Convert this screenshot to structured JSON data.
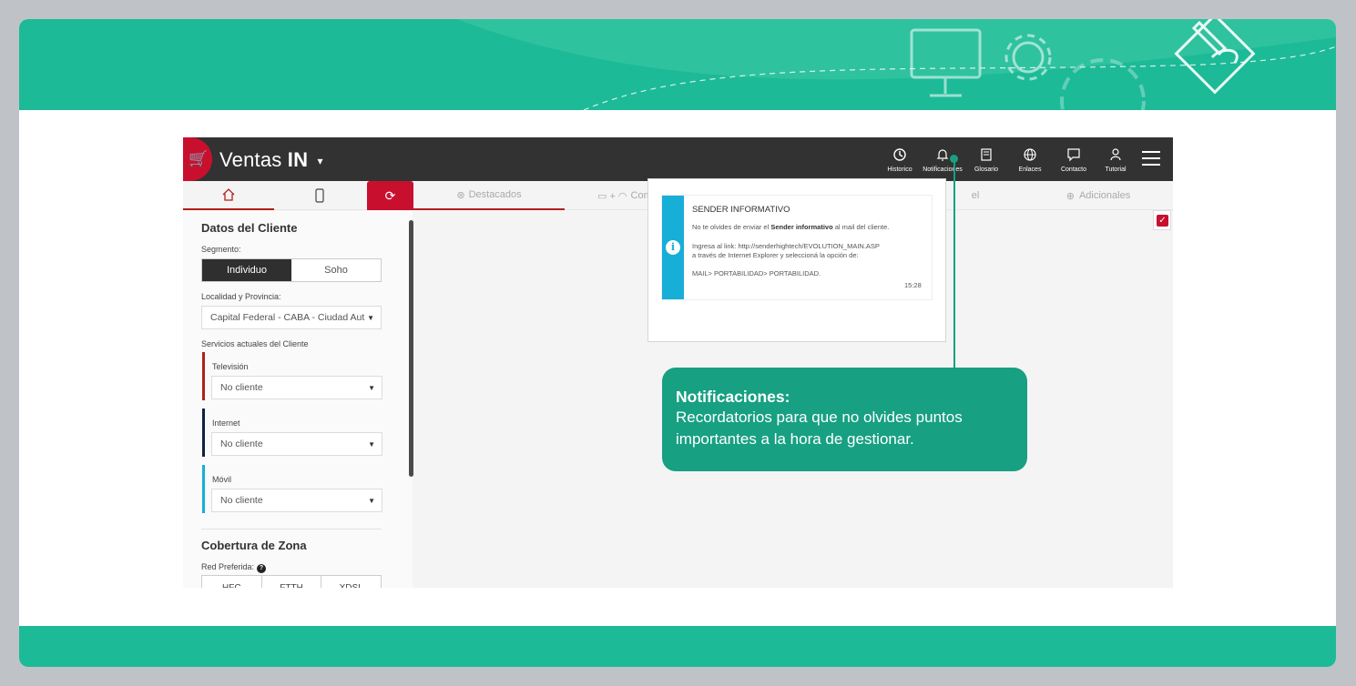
{
  "app": {
    "brand_light": "Ventas",
    "brand_bold": "IN",
    "caret": "▾",
    "nav": [
      {
        "label": "Historico",
        "icon": "history-icon"
      },
      {
        "label": "Notificaciones",
        "icon": "bell-icon"
      },
      {
        "label": "Glosario",
        "icon": "book-icon"
      },
      {
        "label": "Enlaces",
        "icon": "globe-icon"
      },
      {
        "label": "Contacto",
        "icon": "chat-icon"
      },
      {
        "label": "Tutorial",
        "icon": "user-guide-icon"
      }
    ]
  },
  "tabs": {
    "destacados": "Destacados",
    "comp": "Com",
    "el": "el",
    "adicionales": "Adicionales"
  },
  "cliente": {
    "title": "Datos del Cliente",
    "segmento_label": "Segmento:",
    "segmento_options": [
      "Individuo",
      "Soho"
    ],
    "localidad_label": "Localidad y Provincia:",
    "localidad_value": "Capital Federal - CABA - Ciudad Aut",
    "servicios_label": "Servicios actuales del Cliente",
    "servicios": [
      {
        "label": "Televisión",
        "value": "No cliente",
        "color": "#b0211a"
      },
      {
        "label": "Internet",
        "value": "No cliente",
        "color": "#0d2240"
      },
      {
        "label": "Móvil",
        "value": "No cliente",
        "color": "#17aed8"
      }
    ]
  },
  "cobertura": {
    "title": "Cobertura de Zona",
    "red_label": "Red Preferida:",
    "help": "?",
    "options": [
      "HFC",
      "FTTH",
      "XDSL"
    ]
  },
  "notification": {
    "title": "SENDER INFORMATIVO",
    "line1_pre": "No te olvides de enviar el ",
    "line1_bold": "Sender informativo",
    "line1_post": " al mail del cliente.",
    "line2": "Ingresa al link: http://senderhightech/EVOLUTION_MAIN.ASP",
    "line3": "a través de Internet Explorer y seleccioná la opción de:",
    "line4": "MAIL> PORTABILIDAD> PORTABILIDAD.",
    "time": "15:28",
    "info_icon": "i"
  },
  "callout": {
    "title": "Notificaciones:",
    "body_line1": "Recordatorios para que no olvides puntos",
    "body_line2": "importantes a la hora de gestionar."
  },
  "colors": {
    "accent_green": "#1dba97",
    "callout_green": "#17a082",
    "brand_red": "#c8102e",
    "appbar": "#323232",
    "info_blue": "#17aed8"
  }
}
